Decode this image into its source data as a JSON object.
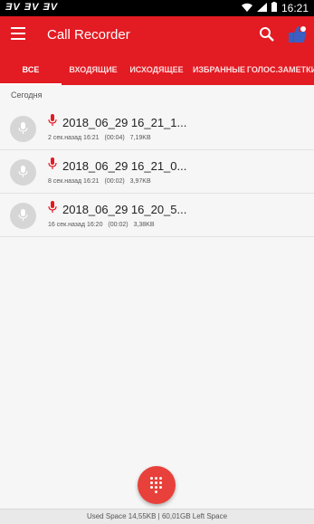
{
  "statusbar": {
    "time": "16:21",
    "left_icons": "ƎV ƎV ƎV"
  },
  "appbar": {
    "title": "Call Recorder"
  },
  "tabs": [
    {
      "label": "ВСЕ"
    },
    {
      "label": "ВХОДЯЩИЕ"
    },
    {
      "label": "ИСХОДЯЩЕЕ"
    },
    {
      "label": "ИЗБРАННЫЕ"
    },
    {
      "label": "ГОЛОС.ЗАМЕТКИ"
    }
  ],
  "section": {
    "label": "Сегодня"
  },
  "recordings": [
    {
      "name": "2018_06_29 16_21_1...",
      "ago": "2 сек.назад 16:21",
      "duration": "(00:04)",
      "size": "7,19KB"
    },
    {
      "name": "2018_06_29 16_21_0...",
      "ago": "8 сек.назад 16:21",
      "duration": "(00:02)",
      "size": "3,97KB"
    },
    {
      "name": "2018_06_29 16_20_5...",
      "ago": "16 сек.назад 16:20",
      "duration": "(00:02)",
      "size": "3,38KB"
    }
  ],
  "footer": {
    "text": "Used Space 14,55KB | 60,01GB Left Space"
  },
  "colors": {
    "primary": "#e31b23",
    "fab": "#e8403a"
  }
}
